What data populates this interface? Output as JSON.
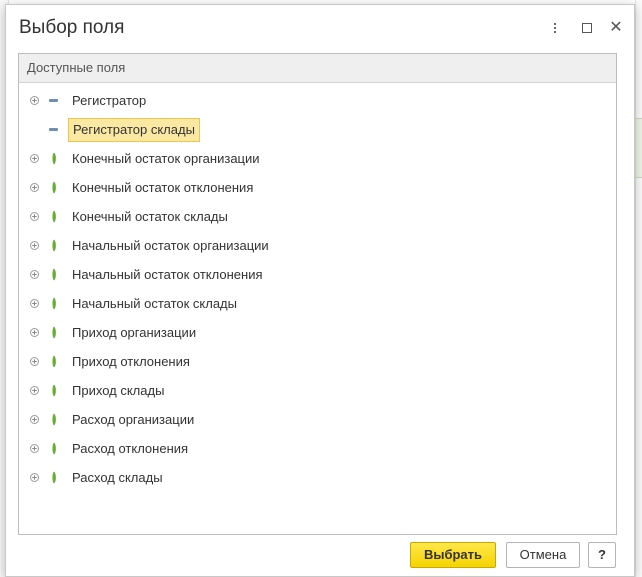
{
  "dialog": {
    "title": "Выбор поля",
    "more_icon": "more-vertical-icon",
    "maximize_icon": "maximize-icon",
    "close_icon": "close-icon"
  },
  "panel": {
    "header": "Доступные поля",
    "items": [
      {
        "label": "Регистратор",
        "kind": "dimension",
        "expandable": true,
        "selected": false
      },
      {
        "label": "Регистратор склады",
        "kind": "dimension",
        "expandable": false,
        "selected": true
      },
      {
        "label": "Конечный остаток организации",
        "kind": "resource",
        "expandable": true,
        "selected": false
      },
      {
        "label": "Конечный остаток отклонения",
        "kind": "resource",
        "expandable": true,
        "selected": false
      },
      {
        "label": "Конечный остаток склады",
        "kind": "resource",
        "expandable": true,
        "selected": false
      },
      {
        "label": "Начальный остаток организации",
        "kind": "resource",
        "expandable": true,
        "selected": false
      },
      {
        "label": "Начальный остаток отклонения",
        "kind": "resource",
        "expandable": true,
        "selected": false
      },
      {
        "label": "Начальный остаток склады",
        "kind": "resource",
        "expandable": true,
        "selected": false
      },
      {
        "label": "Приход организации",
        "kind": "resource",
        "expandable": true,
        "selected": false
      },
      {
        "label": "Приход отклонения",
        "kind": "resource",
        "expandable": true,
        "selected": false
      },
      {
        "label": "Приход склады",
        "kind": "resource",
        "expandable": true,
        "selected": false
      },
      {
        "label": "Расход организации",
        "kind": "resource",
        "expandable": true,
        "selected": false
      },
      {
        "label": "Расход отклонения",
        "kind": "resource",
        "expandable": true,
        "selected": false
      },
      {
        "label": "Расход склады",
        "kind": "resource",
        "expandable": true,
        "selected": false
      }
    ]
  },
  "footer": {
    "ok_label": "Выбрать",
    "cancel_label": "Отмена",
    "help_label": "?"
  },
  "colors": {
    "primary_button": "#f5d400",
    "selection_fill": "#fbe9a3",
    "selection_border": "#f0c64a",
    "dimension_icon": "#6e8fb3",
    "resource_icon": "#7ac143"
  }
}
